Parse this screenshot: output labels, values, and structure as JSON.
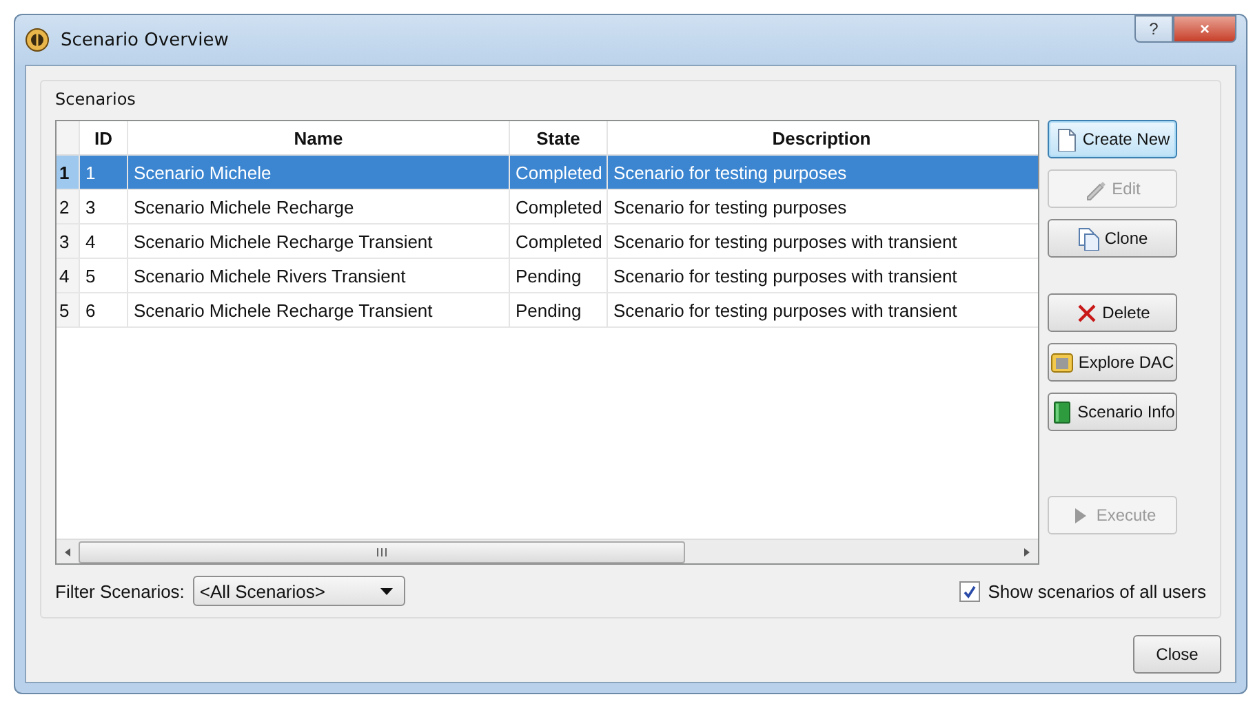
{
  "window": {
    "title": "Scenario Overview",
    "controls": [
      "?",
      "×"
    ]
  },
  "group": {
    "title": "Scenarios"
  },
  "table": {
    "columns": [
      "ID",
      "Name",
      "State",
      "Description"
    ],
    "rows": [
      {
        "number": "1",
        "id": "1",
        "name": "Scenario Michele",
        "state": "Completed",
        "description": "Scenario for testing purposes",
        "selected": true
      },
      {
        "number": "2",
        "id": "3",
        "name": "Scenario Michele Recharge",
        "state": "Completed",
        "description": "Scenario for testing purposes",
        "selected": false
      },
      {
        "number": "3",
        "id": "4",
        "name": "Scenario Michele Recharge Transient",
        "state": "Completed",
        "description": "Scenario for testing purposes with transient",
        "selected": false
      },
      {
        "number": "4",
        "id": "5",
        "name": "Scenario Michele Rivers Transient",
        "state": "Pending",
        "description": "Scenario for testing purposes with transient",
        "selected": false
      },
      {
        "number": "5",
        "id": "6",
        "name": "Scenario Michele Recharge Transient",
        "state": "Pending",
        "description": "Scenario for testing purposes with transient",
        "selected": false
      }
    ]
  },
  "button_groups": [
    [
      {
        "label": "Create New",
        "kind": "new",
        "disabled": false,
        "focused": true
      },
      {
        "label": "Edit",
        "kind": "edit",
        "disabled": true,
        "focused": false
      },
      {
        "label": "Clone",
        "kind": "clone",
        "disabled": false,
        "focused": false
      }
    ],
    [
      {
        "label": "Delete",
        "kind": "delete",
        "disabled": false,
        "focused": false
      },
      {
        "label": "Explore DAC",
        "kind": "explore",
        "disabled": false,
        "focused": false
      },
      {
        "label": "Scenario Info",
        "kind": "info",
        "disabled": false,
        "focused": false
      }
    ],
    [
      {
        "label": "Execute",
        "kind": "execute",
        "disabled": true,
        "focused": false
      }
    ]
  ],
  "filter": {
    "label": "Filter Scenarios:",
    "value": "<All Scenarios>"
  },
  "show_all_users": {
    "label": "Show scenarios of all users",
    "checked": true
  },
  "close_button": {
    "label": "Close"
  }
}
